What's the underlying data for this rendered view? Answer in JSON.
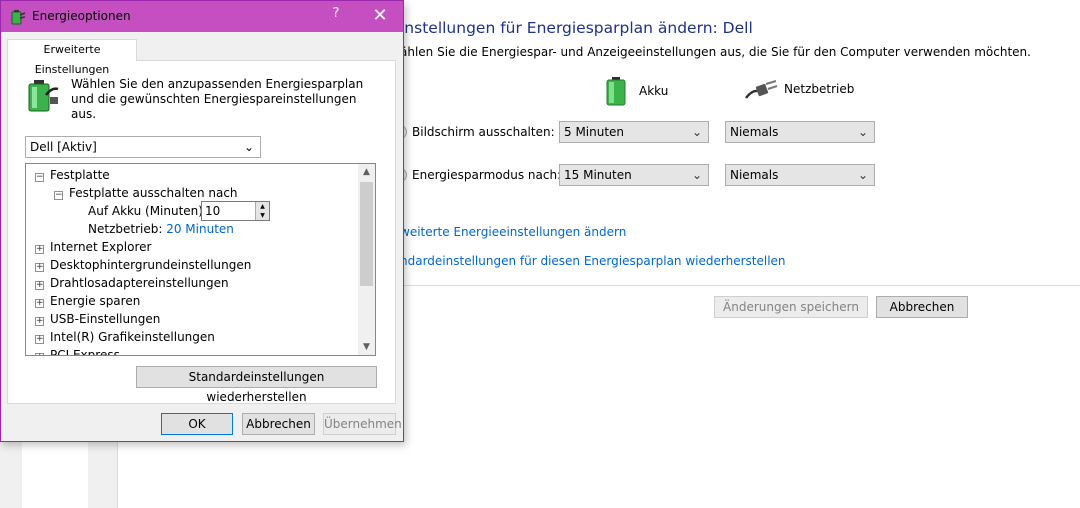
{
  "background_window": {
    "title": "instellungen für Energiesparplan ändern: Dell",
    "subtitle": "ählen Sie die Energiespar- und Anzeigeeinstellungen aus, die Sie für den Computer verwenden möchten.",
    "columns": {
      "battery": "Akku",
      "plugged_in": "Netzbetrieb"
    },
    "rows": [
      {
        "label": "Bildschirm ausschalten:",
        "battery_value": "5 Minuten",
        "plugged_value": "Niemals"
      },
      {
        "label": "Energiesparmodus nach:",
        "battery_value": "15 Minuten",
        "plugged_value": "Niemals"
      }
    ],
    "links": {
      "advanced": "weiterte Energieeinstellungen ändern",
      "restore": "ndardeinstellungen für diesen Energiesparplan wiederherstellen"
    },
    "buttons": {
      "save": "Änderungen speichern",
      "cancel": "Abbrechen"
    }
  },
  "dialog": {
    "title": "Energieoptionen",
    "help_glyph": "?",
    "close_glyph": "✕",
    "tab": "Erweiterte Einstellungen",
    "description": "Wählen Sie den anzupassenden Energiesparplan und die gewünschten Energiespareinstellungen aus.",
    "plan_select": "Dell [Aktiv]",
    "tree": {
      "festplatte": "Festplatte",
      "festplatte_aus": "Festplatte ausschalten nach",
      "akku_label": "Auf Akku (Minuten):",
      "akku_value": "10",
      "netz_label": "Netzbetrieb:",
      "netz_value": "20 Minuten",
      "items": [
        "Internet Explorer",
        "Desktophintergrundeinstellungen",
        "Drahtlosadaptereinstellungen",
        "Energie sparen",
        "USB-Einstellungen",
        "Intel(R) Grafikeinstellungen",
        "PCI Express"
      ]
    },
    "restore_button": "Standardeinstellungen wiederherstellen",
    "buttons": {
      "ok": "OK",
      "cancel": "Abbrechen",
      "apply": "Übernehmen"
    }
  }
}
